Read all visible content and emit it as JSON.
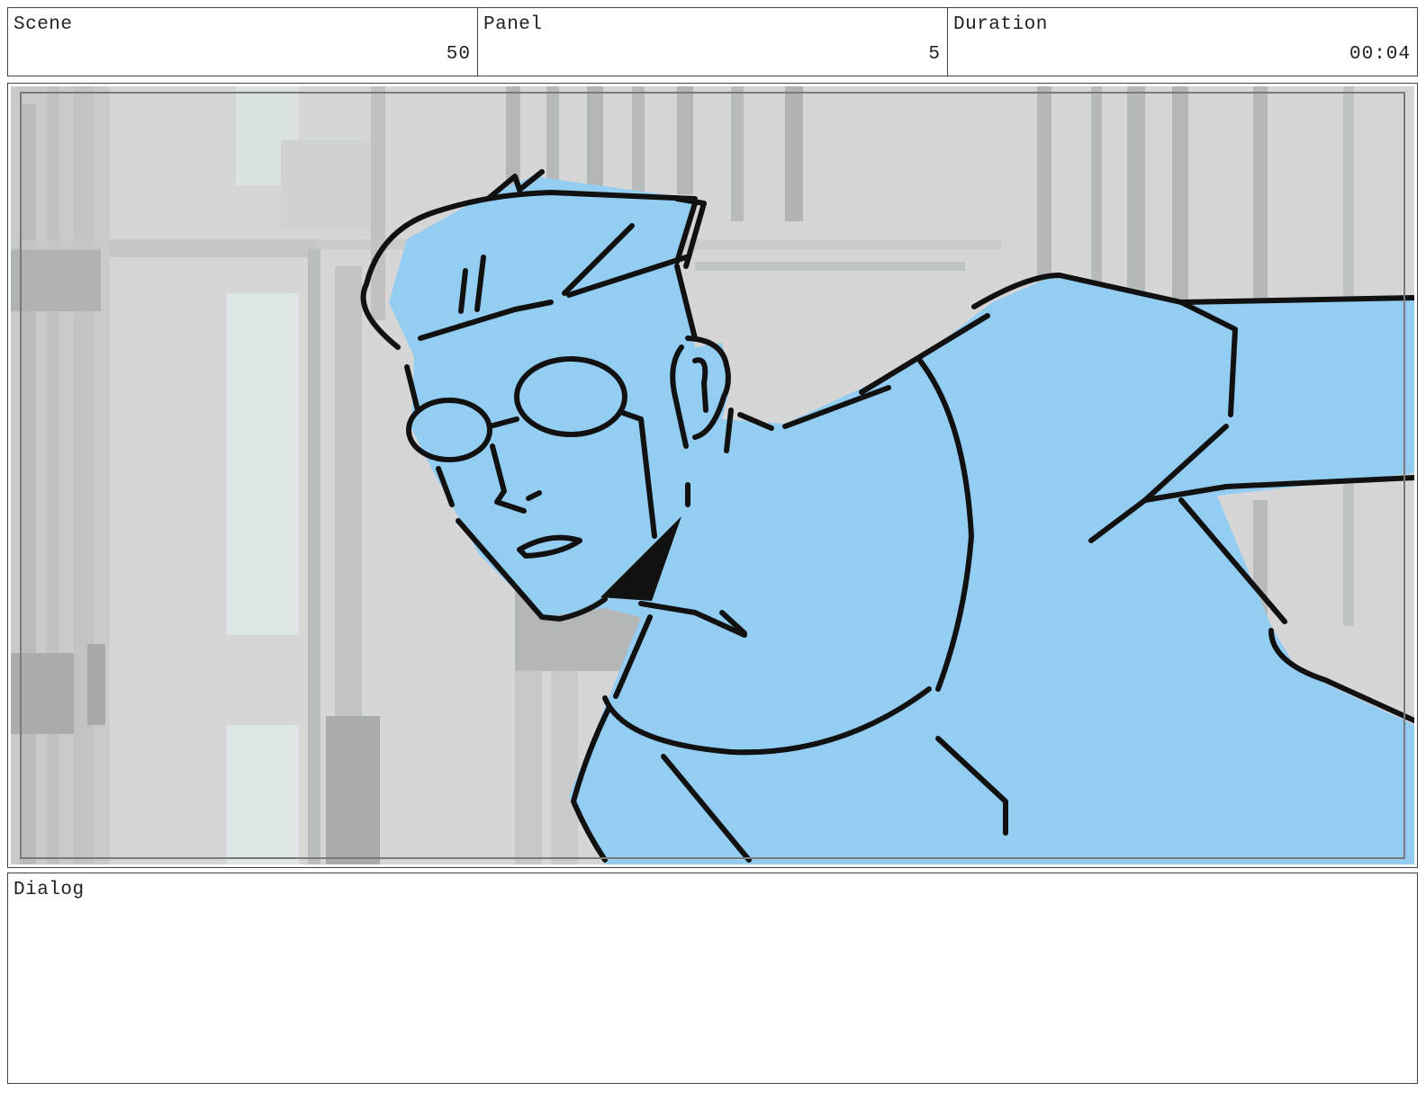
{
  "header": {
    "scene": {
      "label": "Scene",
      "value": "50"
    },
    "panel": {
      "label": "Panel",
      "value": "5"
    },
    "duration": {
      "label": "Duration",
      "value": "00:04"
    }
  },
  "dialog": {
    "label": "Dialog",
    "text": ""
  },
  "colors": {
    "character_fill": "#93cdf2",
    "line_art": "#111111",
    "background_light": "#d8d8d8",
    "background_mid": "#b8bcbc",
    "background_window": "#dfe6e8",
    "frame_border": "#444444"
  }
}
